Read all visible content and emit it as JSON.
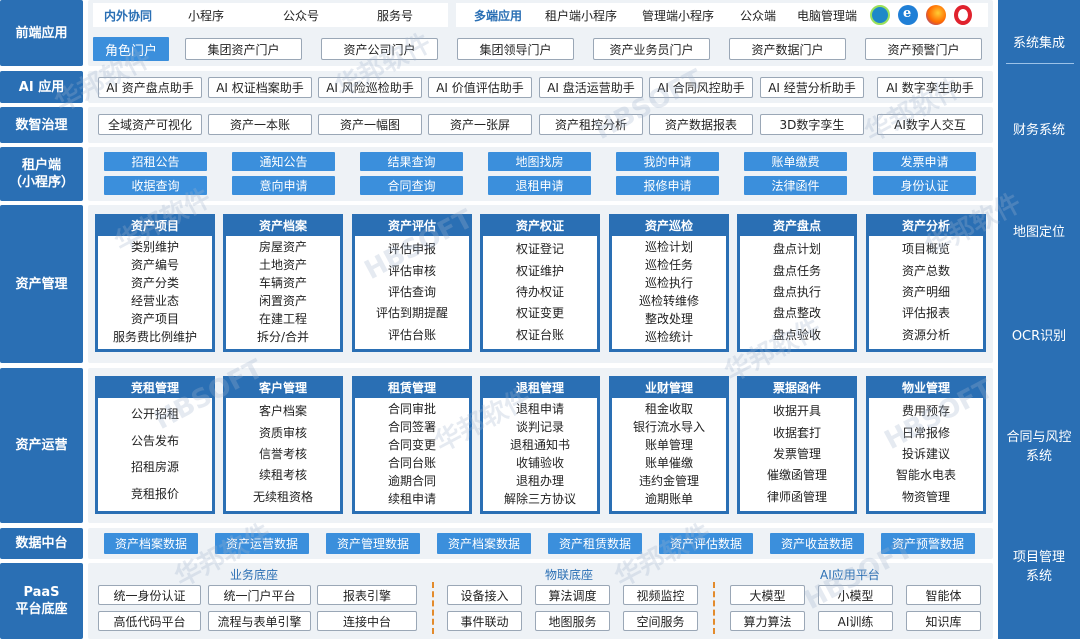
{
  "left_labels": {
    "frontend": "前端应用",
    "ai": "AI 应用",
    "gov": "数智治理",
    "tenant": "租户端\n（小程序）",
    "asset_mgmt": "资产管理",
    "asset_ops": "资产运营",
    "data_center": "数据中台",
    "paas": "PaaS\n平台底座"
  },
  "right_items": [
    "系统集成",
    "财务系统",
    "地图定位",
    "OCR识别",
    "合同与风控\n系统",
    "项目管理\n系统"
  ],
  "top": {
    "internal_label": "内外协同",
    "internal_items": [
      "小程序",
      "公众号",
      "服务号"
    ],
    "multi_label": "多端应用",
    "multi_items": [
      "租户端小程序",
      "管理端小程序",
      "公众端",
      "电脑管理端"
    ]
  },
  "browsers": [
    "edge-browser-icon",
    "ie-browser-icon",
    "firefox-browser-icon",
    "opera-browser-icon"
  ],
  "portals": [
    "角色门户",
    "集团资产门户",
    "资产公司门户",
    "集团领导门户",
    "资产业务员门户",
    "资产数据门户",
    "资产预警门户"
  ],
  "ai_apps": [
    "AI 资产盘点助手",
    "AI 权证档案助手",
    "AI 风险巡检助手",
    "AI 价值评估助手",
    "AI 盘活运营助手",
    "AI 合同风控助手",
    "AI 经营分析助手",
    "AI 数字孪生助手"
  ],
  "gov_items": [
    "全域资产可视化",
    "资产一本账",
    "资产一幅图",
    "资产一张屏",
    "资产租控分析",
    "资产数据报表",
    "3D数字孪生",
    "AI数字人交互"
  ],
  "tenant_row1": [
    "招租公告",
    "通知公告",
    "结果查询",
    "地图找房",
    "我的申请",
    "账单缴费",
    "发票申请"
  ],
  "tenant_row2": [
    "收据查询",
    "意向申请",
    "合同查询",
    "退租申请",
    "报修申请",
    "法律函件",
    "身份认证"
  ],
  "asset_mgmt_cards": [
    {
      "title": "资产项目",
      "items": [
        "类别维护",
        "资产编号",
        "资产分类",
        "经营业态",
        "资产项目",
        "服务费比例维护"
      ]
    },
    {
      "title": "资产档案",
      "items": [
        "房屋资产",
        "土地资产",
        "车辆资产",
        "闲置资产",
        "在建工程",
        "拆分/合并"
      ]
    },
    {
      "title": "资产评估",
      "items": [
        "评估申报",
        "评估审核",
        "评估查询",
        "评估到期提醒",
        "评估台账"
      ]
    },
    {
      "title": "资产权证",
      "items": [
        "权证登记",
        "权证维护",
        "待办权证",
        "权证变更",
        "权证台账"
      ]
    },
    {
      "title": "资产巡检",
      "items": [
        "巡检计划",
        "巡检任务",
        "巡检执行",
        "巡检转维修",
        "整改处理",
        "巡检统计"
      ]
    },
    {
      "title": "资产盘点",
      "items": [
        "盘点计划",
        "盘点任务",
        "盘点执行",
        "盘点整改",
        "盘点验收"
      ]
    },
    {
      "title": "资产分析",
      "items": [
        "项目概览",
        "资产总数",
        "资产明细",
        "评估报表",
        "资源分析"
      ]
    }
  ],
  "asset_ops_cards": [
    {
      "title": "竞租管理",
      "items": [
        "公开招租",
        "公告发布",
        "招租房源",
        "竞租报价"
      ]
    },
    {
      "title": "客户管理",
      "items": [
        "客户档案",
        "资质审核",
        "信誉考核",
        "续租考核",
        "无续租资格"
      ]
    },
    {
      "title": "租赁管理",
      "items": [
        "合同审批",
        "合同签署",
        "合同变更",
        "合同台账",
        "逾期合同",
        "续租申请"
      ]
    },
    {
      "title": "退租管理",
      "items": [
        "退租申请",
        "谈判记录",
        "退租通知书",
        "收铺验收",
        "退租办理",
        "解除三方协议"
      ]
    },
    {
      "title": "业财管理",
      "items": [
        "租金收取",
        "银行流水导入",
        "账单管理",
        "账单催缴",
        "违约金管理",
        "逾期账单"
      ]
    },
    {
      "title": "票据函件",
      "items": [
        "收据开具",
        "收据套打",
        "发票管理",
        "催缴函管理",
        "律师函管理"
      ]
    },
    {
      "title": "物业管理",
      "items": [
        "费用预存",
        "日常报修",
        "投诉建议",
        "智能水电表",
        "物资管理"
      ]
    }
  ],
  "data_center": [
    "资产档案数据",
    "资产运营数据",
    "资产管理数据",
    "资产档案数据",
    "资产租赁数据",
    "资产评估数据",
    "资产收益数据",
    "资产预警数据"
  ],
  "paas": {
    "groups": [
      {
        "title": "业务底座",
        "row1": [
          "统一身份认证",
          "统一门户平台",
          "报表引擎"
        ],
        "row2": [
          "高低代码平台",
          "流程与表单引擎",
          "连接中台"
        ]
      },
      {
        "title": "物联底座",
        "row1": [
          "设备接入",
          "算法调度",
          "视频监控"
        ],
        "row2": [
          "事件联动",
          "地图服务",
          "空间服务"
        ]
      },
      {
        "title": "AI应用平台",
        "row1": [
          "大模型",
          "小模型",
          "智能体"
        ],
        "row2": [
          "算力算法",
          "AI训练",
          "知识库"
        ]
      }
    ]
  },
  "watermark": [
    "华邦软件",
    "HBSOFT"
  ],
  "colors": {
    "primary": "#2a6fb4",
    "button": "#3b8fdc",
    "panel": "#eef2f6",
    "accent_dash": "#e38b2c"
  }
}
